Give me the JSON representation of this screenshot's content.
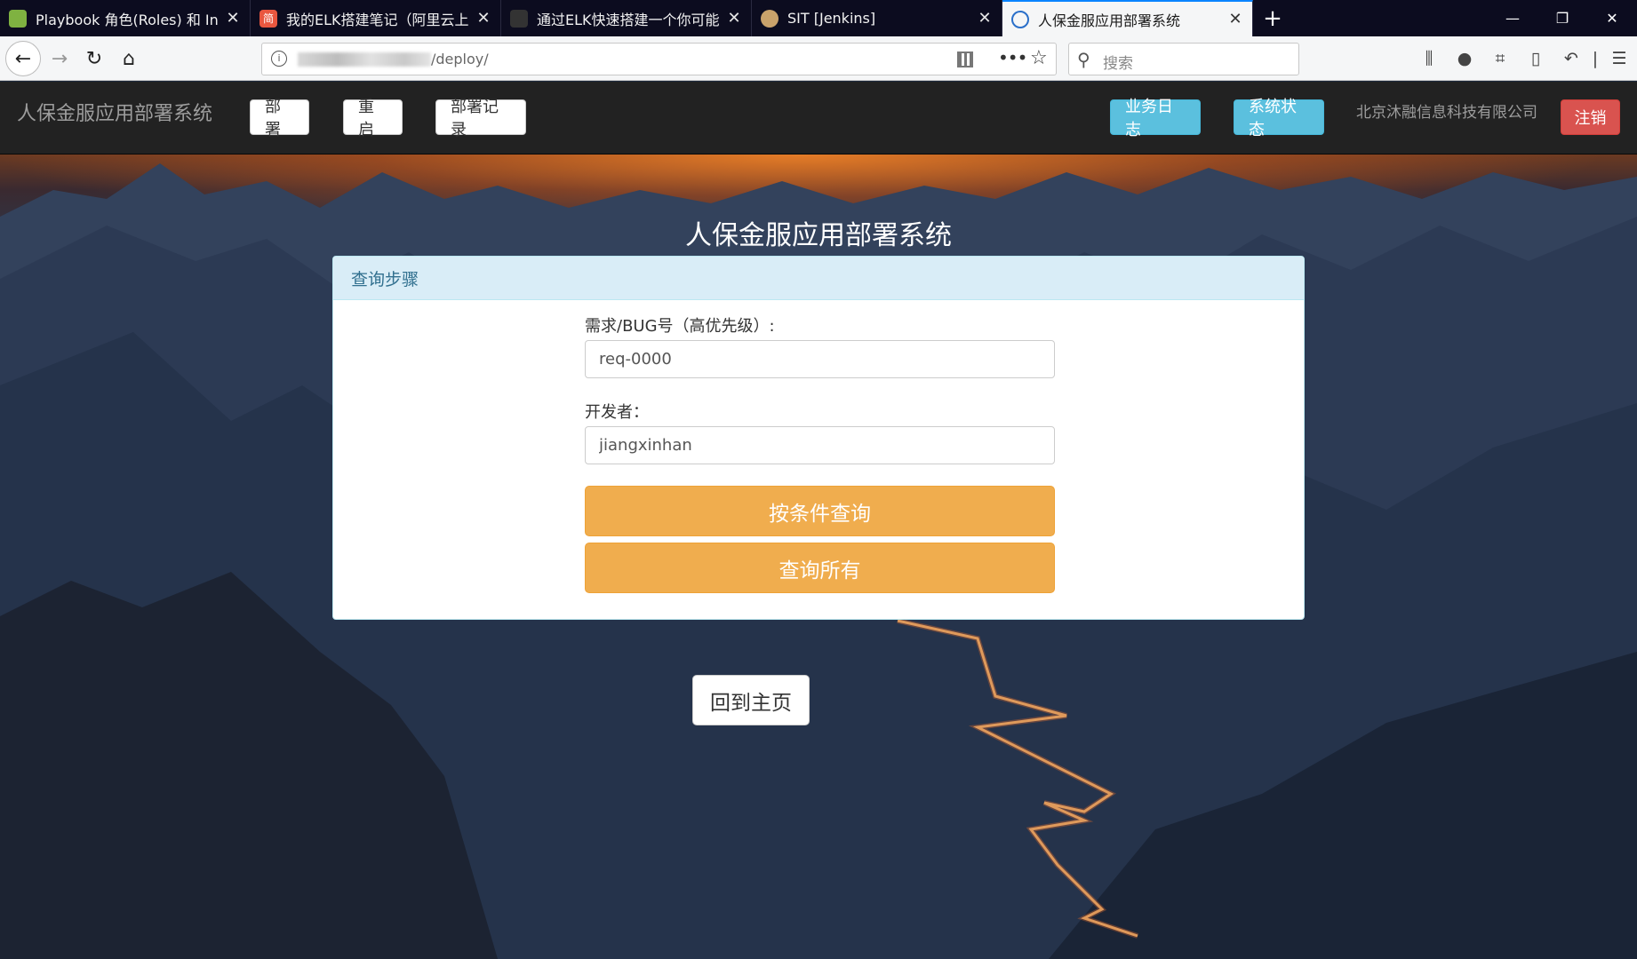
{
  "browser": {
    "tabs": [
      {
        "title": "Playbook 角色(Roles) 和 Inclu",
        "favicon_color": "#7fb241",
        "favicon_glyph": "",
        "active": false
      },
      {
        "title": "我的ELK搭建笔记（阿里云上部",
        "favicon_color": "#e9573f",
        "favicon_glyph": "简",
        "active": false
      },
      {
        "title": "通过ELK快速搭建一个你可能需",
        "favicon_color": "#333333",
        "favicon_glyph": "",
        "active": false
      },
      {
        "title": "SIT [Jenkins]",
        "favicon_color": "#c9a26b",
        "favicon_glyph": "",
        "active": false
      },
      {
        "title": "人保金服应用部署系统",
        "favicon_color": "#2a6fc9",
        "favicon_glyph": "",
        "active": true
      }
    ],
    "url": "/deploy/",
    "search_placeholder": "搜索"
  },
  "app": {
    "brand": "人保金服应用部署系统",
    "nav_buttons": [
      "部署",
      "重启",
      "部署记录"
    ],
    "right_buttons": [
      "业务日志",
      "系统状态"
    ],
    "company": "北京沐融信息科技有限公司",
    "logout": "注销"
  },
  "main": {
    "title": "人保金服应用部署系统",
    "panel_heading": "查询步骤",
    "fields": [
      {
        "label": "需求/BUG号（高优先级）:",
        "value": "req-0000"
      },
      {
        "label": "开发者：",
        "value": "jiangxinhan"
      }
    ],
    "query_button": "按条件查询",
    "query_all_button": "查询所有",
    "home_button": "回到主页"
  },
  "colors": {
    "appbar": "#222222",
    "primary_warning": "#f0ad4e",
    "info": "#5bc0de",
    "danger": "#d9534f",
    "panel_heading_bg": "#d9edf7"
  }
}
